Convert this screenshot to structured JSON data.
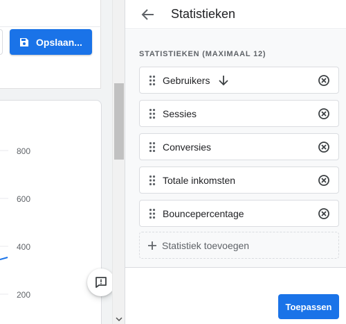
{
  "toolbar": {
    "save_label": "Opslaan..."
  },
  "chart": {
    "y_ticks": [
      "800",
      "600",
      "400",
      "200"
    ]
  },
  "panel": {
    "title": "Statistieken",
    "section_label": "STATISTIEKEN (MAXIMAAL 12)",
    "metrics": [
      {
        "label": "Gebruikers",
        "sorted": true
      },
      {
        "label": "Sessies"
      },
      {
        "label": "Conversies"
      },
      {
        "label": "Totale inkomsten"
      },
      {
        "label": "Bouncepercentage"
      }
    ],
    "add_label": "Statistiek toevoegen",
    "apply_label": "Toepassen"
  },
  "colors": {
    "accent": "#1a73e8",
    "panel_bg": "#f8f9fa",
    "page_bg": "#f1f3f4"
  },
  "icons": [
    "save-icon",
    "back-arrow-icon",
    "drag-handle-icon",
    "sort-descending-icon",
    "remove-circle-icon",
    "plus-icon",
    "feedback-icon"
  ]
}
